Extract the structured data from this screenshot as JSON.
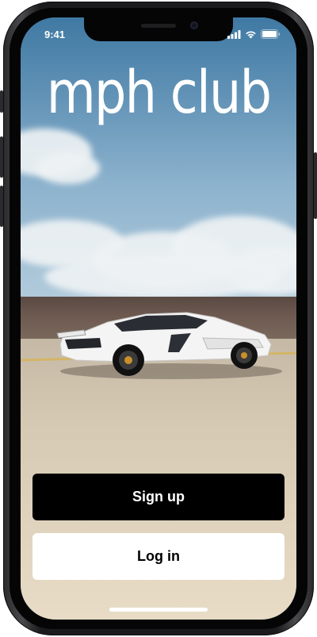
{
  "status_bar": {
    "time": "9:41",
    "signal_icon": "cellular-signal-icon",
    "wifi_icon": "wifi-icon",
    "battery_icon": "battery-icon"
  },
  "brand": {
    "logo_text": "mph club"
  },
  "actions": {
    "signup_label": "Sign up",
    "login_label": "Log in"
  },
  "colors": {
    "signup_bg": "#000000",
    "signup_text": "#ffffff",
    "login_bg": "#ffffff",
    "login_text": "#000000",
    "device_frame": "#1b1b1d"
  }
}
